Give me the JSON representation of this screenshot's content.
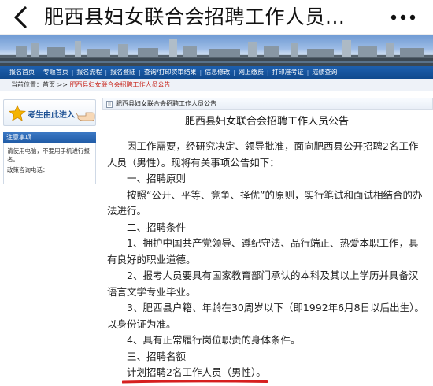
{
  "topbar": {
    "title": "肥西县妇女联合会招聘工作人员...",
    "back_icon": "back-chevron-icon",
    "more_icon": "more-dots-icon"
  },
  "nav": {
    "items": [
      "报名首页",
      "专题首页",
      "报名流程",
      "报名登陆",
      "查询/打印资审结果",
      "信息修改",
      "网上缴费",
      "打印准考证",
      "成绩查询"
    ]
  },
  "breadcrumb": {
    "prefix": "当前位置：",
    "home": "首页",
    "separator": " >> ",
    "current": "肥西县妇女联合会招聘工作人员公告"
  },
  "sidebar": {
    "promo_label": "考生由此进入",
    "notice_title": "注意事项",
    "notice_lines": [
      "请使用电脑，不要用手机进行报名。",
      "政策咨询电话："
    ]
  },
  "main": {
    "header_label": "肥西县妇女联合会招聘工作人员公告",
    "title": "肥西县妇女联合会招聘工作人员公告",
    "paragraphs": [
      "因工作需要，经研究决定、领导批准，面向肥西县公开招聘2名工作人员（男性）。现将有关事项公告如下：",
      "一、招聘原则",
      "按照“公开、平等、竞争、择优”的原则，实行笔试和面试相结合的办法进行。",
      "二、招聘条件",
      "1、拥护中国共产党领导、遵纪守法、品行端正、热爱本职工作，具有良好的职业道德。",
      "2、报考人员要具有国家教育部门承认的本科及其以上学历并具备汉语言文学专业毕业。",
      "3、肥西县户籍、年龄在30周岁以下（即1992年6月8日以后出生）。以身份证为准。",
      "4、具有正常履行岗位职责的身体条件。",
      "三、招聘名额"
    ],
    "highlight": "计划招聘2名工作人员（男性）。"
  },
  "colors": {
    "nav_blue": "#1d5fae",
    "breadcrumb_current": "#c8261c",
    "underline_red": "#d61f1f"
  }
}
